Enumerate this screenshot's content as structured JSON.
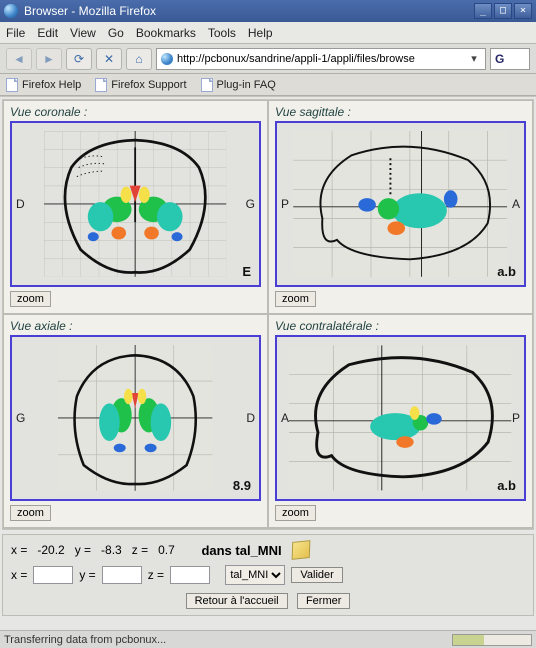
{
  "window": {
    "title": "Browser - Mozilla Firefox",
    "min": "_",
    "max": "□",
    "close": "×"
  },
  "menus": [
    "File",
    "Edit",
    "View",
    "Go",
    "Bookmarks",
    "Tools",
    "Help"
  ],
  "nav": {
    "back": "◄",
    "fwd": "►",
    "reload": "⟳",
    "stop": "✕",
    "home": "⌂"
  },
  "url": "http://pcbonux/sandrine/appli-1/appli/files/browse",
  "url_dd": "▾",
  "gosearch": "G",
  "bookmarks": [
    {
      "label": "Firefox Help"
    },
    {
      "label": "Firefox Support"
    },
    {
      "label": "Plug-in FAQ"
    }
  ],
  "views": [
    {
      "title": "Vue coronale :",
      "left": "D",
      "right": "G",
      "corner": "E",
      "zoom": "zoom"
    },
    {
      "title": "Vue sagittale :",
      "left": "P",
      "right": "A",
      "corner": "a.b",
      "zoom": "zoom"
    },
    {
      "title": "Vue axiale :",
      "left": "G",
      "right": "D",
      "corner": "8.9",
      "zoom": "zoom"
    },
    {
      "title": "Vue contralatérale :",
      "left": "A",
      "right": "P",
      "corner": "a.b",
      "zoom": "zoom"
    }
  ],
  "coords": {
    "x_lbl": "x =",
    "x": "-20.2",
    "y_lbl": "y =",
    "y": "-8.3",
    "z_lbl": "z =",
    "z": "0.7",
    "dans_lbl": "dans",
    "space": "tal_MNI",
    "x2_lbl": "x =",
    "y2_lbl": "y =",
    "z2_lbl": "z =",
    "select_opt": "tal_MNI",
    "valider": "Valider",
    "retour": "Retour à l'accueil",
    "fermer": "Fermer"
  },
  "status": "Transferring data from pcbonux...",
  "colors": {
    "blue": "#2a6ad8",
    "green": "#1fc14a",
    "teal": "#28c7b0",
    "orange": "#f07828",
    "yellow": "#f6e04a",
    "red": "#e14436"
  }
}
